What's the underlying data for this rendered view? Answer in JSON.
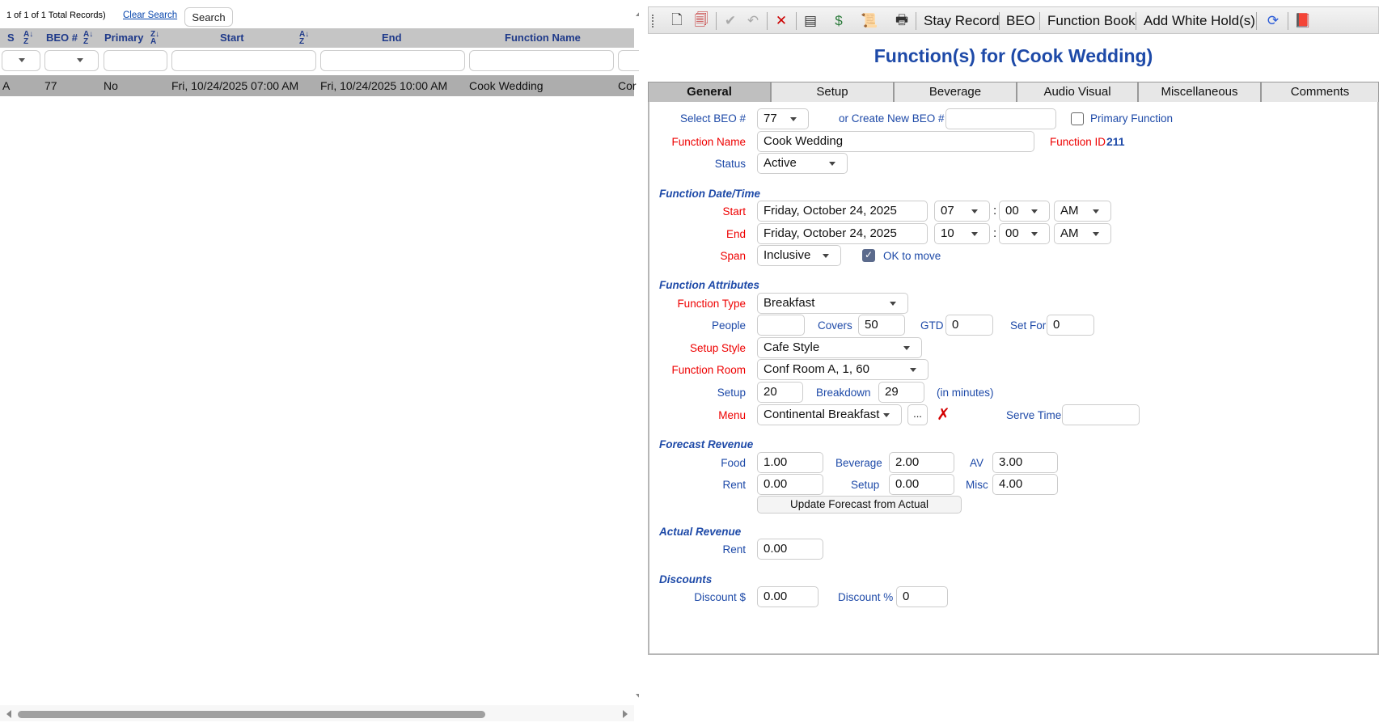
{
  "grid": {
    "record_info": "1 of 1 of 1 Total Records)",
    "clear_search": "Clear Search",
    "search_button": "Search",
    "columns": {
      "s": "S",
      "beo": "BEO #",
      "primary": "Primary",
      "start": "Start",
      "end": "End",
      "function_name": "Function Name"
    },
    "sort_icon": "sort-az-icon",
    "row": {
      "s": "A",
      "beo": "77",
      "primary": "No",
      "start": "Fri, 10/24/2025 07:00 AM",
      "end": "Fri, 10/24/2025 10:00 AM",
      "function_name": "Cook Wedding",
      "extra": "Cor"
    }
  },
  "toolbar": {
    "stay_record": "Stay Record",
    "beo": "BEO",
    "function_book": "Function Book",
    "add_white_holds": "Add White Hold(s)"
  },
  "title": "Function(s) for (Cook Wedding)",
  "tabs": [
    "General",
    "Setup",
    "Beverage",
    "Audio Visual",
    "Miscellaneous",
    "Comments"
  ],
  "form": {
    "select_beo_label": "Select BEO #",
    "select_beo_value": "77",
    "create_beo_label": "or Create New BEO #",
    "create_beo_value": "",
    "primary_function_label": "Primary Function",
    "function_name_label": "Function Name",
    "function_name_value": "Cook Wedding",
    "function_id_label": "Function ID",
    "function_id_value": "211",
    "status_label": "Status",
    "status_value": "Active",
    "section_datetime": "Function Date/Time",
    "start_label": "Start",
    "start_date": "Friday, October 24, 2025",
    "start_hour": "07",
    "start_min": "00",
    "start_ampm": "AM",
    "end_label": "End",
    "end_date": "Friday, October 24, 2025",
    "end_hour": "10",
    "end_min": "00",
    "end_ampm": "AM",
    "colon": ":",
    "span_label": "Span",
    "span_value": "Inclusive",
    "ok_to_move_label": "OK to move",
    "section_attributes": "Function Attributes",
    "function_type_label": "Function Type",
    "function_type_value": "Breakfast",
    "people_label": "People",
    "people_value": "",
    "covers_label": "Covers",
    "covers_value": "50",
    "gtd_label": "GTD",
    "gtd_value": "0",
    "set_for_label": "Set For",
    "set_for_value": "0",
    "setup_style_label": "Setup Style",
    "setup_style_value": "Cafe Style",
    "function_room_label": "Function Room",
    "function_room_value": "Conf Room A, 1, 60",
    "setup_label": "Setup",
    "setup_value": "20",
    "breakdown_label": "Breakdown",
    "breakdown_value": "29",
    "minutes_note": "(in minutes)",
    "menu_label": "Menu",
    "menu_value": "Continental Breakfast",
    "menu_more": "...",
    "serve_time_label": "Serve Time",
    "serve_time_value": "",
    "section_forecast": "Forecast Revenue",
    "food_label": "Food",
    "food_value": "1.00",
    "beverage_label": "Beverage",
    "beverage_value": "2.00",
    "av_label": "AV",
    "av_value": "3.00",
    "rent_label": "Rent",
    "rent_value": "0.00",
    "fsetup_label": "Setup",
    "fsetup_value": "0.00",
    "misc_label": "Misc",
    "misc_value": "4.00",
    "update_forecast": "Update Forecast from Actual",
    "section_actual": "Actual Revenue",
    "actual_rent_label": "Rent",
    "actual_rent_value": "0.00",
    "section_discounts": "Discounts",
    "discount_dollar_label": "Discount $",
    "discount_dollar_value": "0.00",
    "discount_pct_label": "Discount %",
    "discount_pct_value": "0"
  }
}
